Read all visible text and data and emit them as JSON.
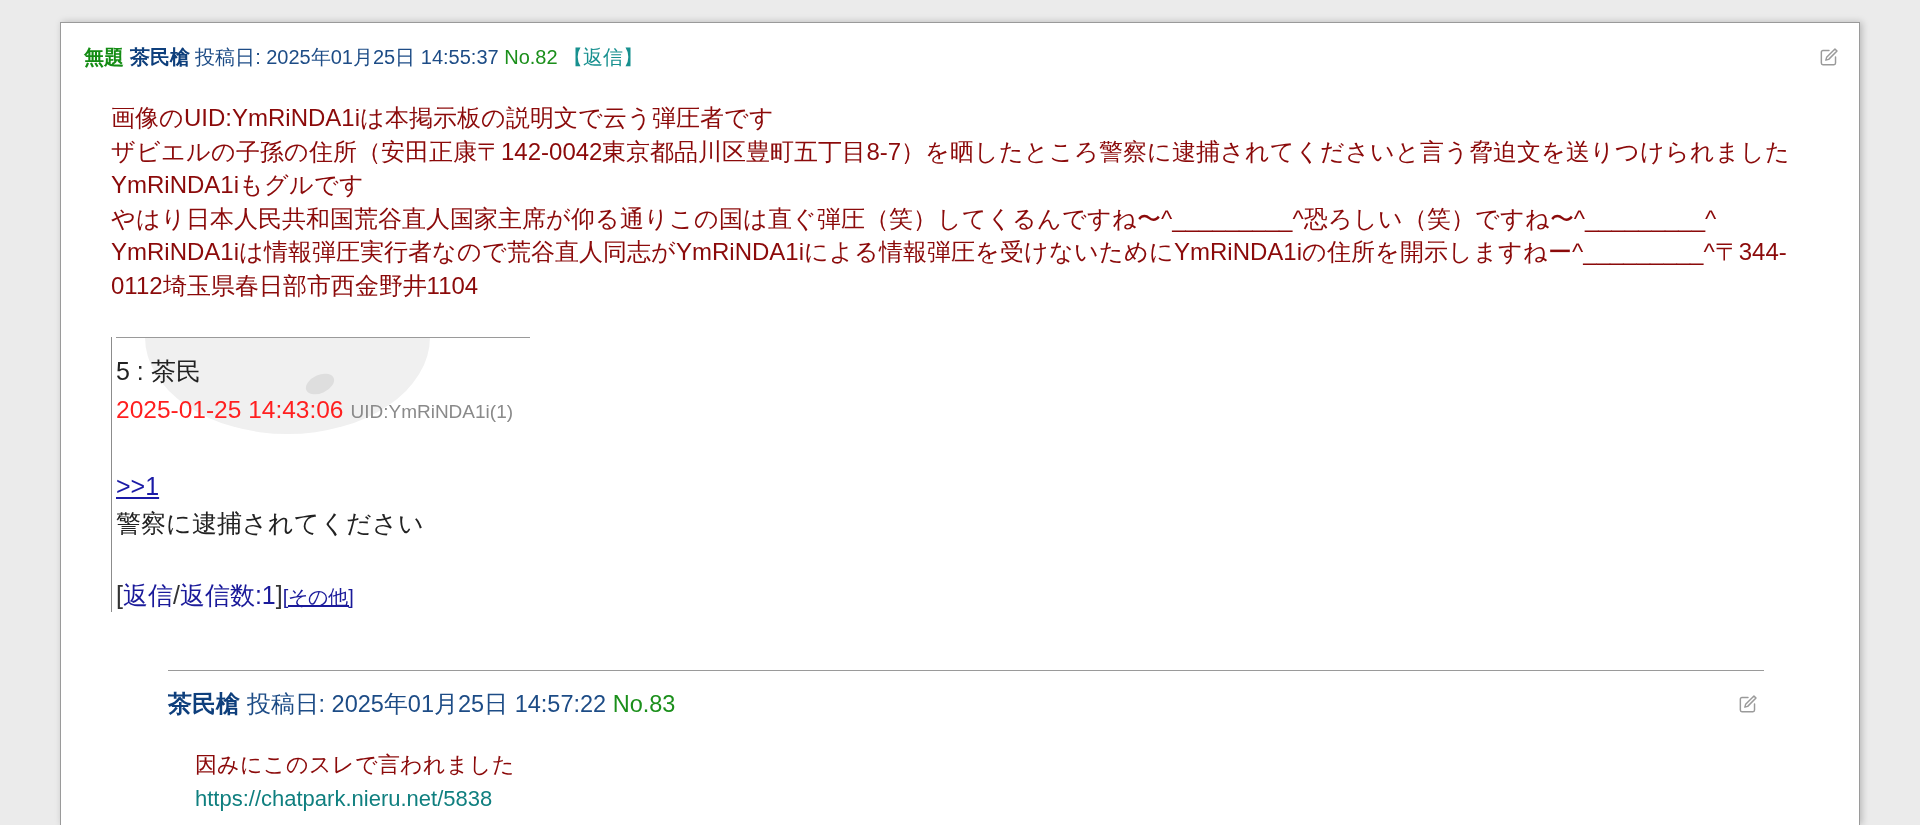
{
  "post": {
    "title": "無題",
    "author": "茶民槍",
    "posted": "投稿日: 2025年01月25日 14:55:37",
    "number": "No.82",
    "reply_link": "【返信】",
    "message_lines": [
      "画像のUID:YmRiNDA1iは本掲示板の説明文で云う弾圧者です",
      "ザビエルの子孫の住所（安田正康〒142-0042東京都品川区豊町五丁目8-7）を晒したところ警察に逮捕されてくださいと言う脅迫文を送りつけられました",
      "YmRiNDA1iもグルです",
      "やはり日本人民共和国荒谷直人国家主席が仰る通りこの国は直ぐ弾圧（笑）してくるんですね〜^_________^恐ろしい（笑）ですね〜^_________^",
      "YmRiNDA1iは情報弾圧実行者なので荒谷直人同志がYmRiNDA1iによる情報弾圧を受けないためにYmRiNDA1iの住所を開示しますねー^_________^〒344-0112埼玉県春日部市西金野井1104"
    ],
    "screenshot": {
      "heading": "5 : 茶民",
      "date": "2025-01-25 14:43:06",
      "uid": "UID:YmRiNDA1i(1)",
      "anchor": ">>1",
      "message": "警察に逮捕されてください",
      "footer": {
        "open": "[",
        "reply": "返信",
        "separator": "/",
        "reply_count": "返信数:1",
        "close": "]",
        "other": "[その他]"
      }
    },
    "replies": [
      {
        "author": "茶民槍",
        "posted": "投稿日: 2025年01月25日 14:57:22",
        "number": "No.83",
        "message_lines": [
          "因みにこのスレで言われました"
        ],
        "link": "https://chatpark.nieru.net/5838"
      }
    ]
  }
}
